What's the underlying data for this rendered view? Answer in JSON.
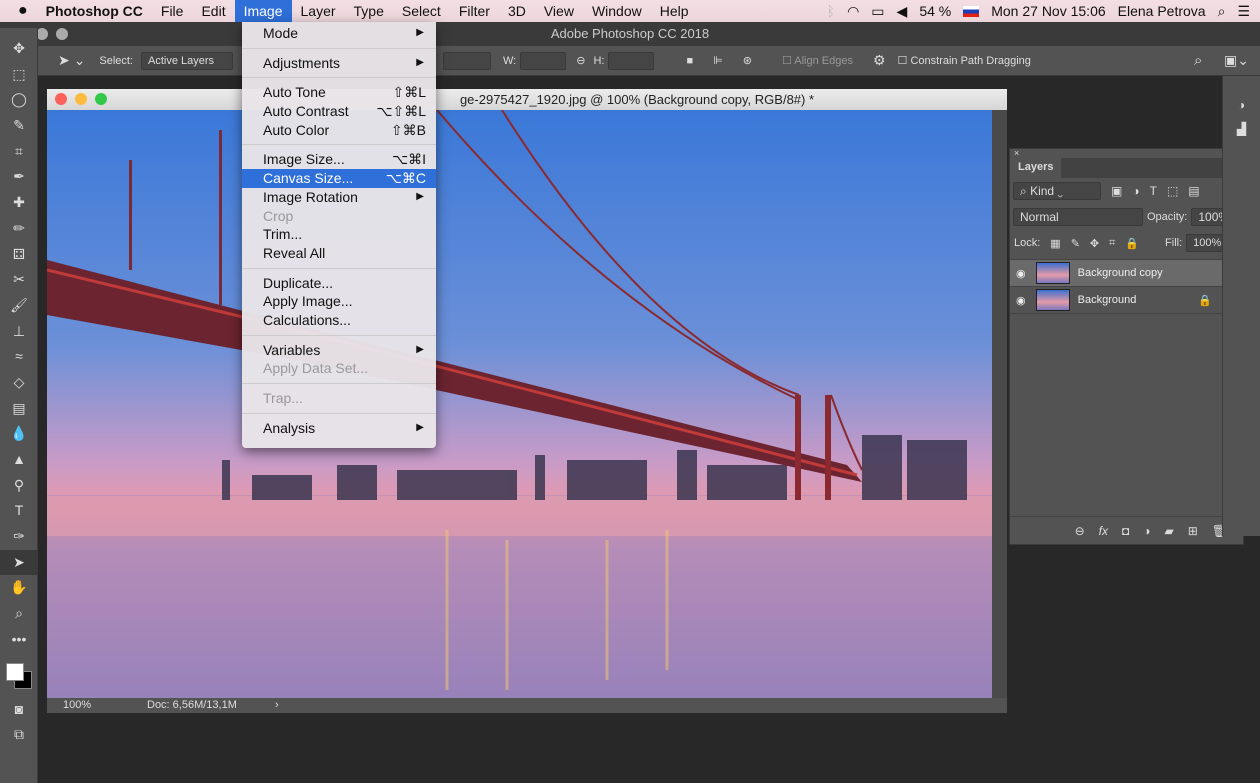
{
  "menubar": {
    "apple": "",
    "app": "Photoshop CC",
    "items": [
      "File",
      "Edit",
      "Image",
      "Layer",
      "Type",
      "Select",
      "Filter",
      "3D",
      "View",
      "Window",
      "Help"
    ],
    "battery": "54 %",
    "datetime": "Mon 27 Nov 15:06",
    "user": "Elena Petrova"
  },
  "window": {
    "title": "Adobe Photoshop CC 2018"
  },
  "options": {
    "select_label": "Select:",
    "select_value": "Active Layers",
    "w_label": "W:",
    "h_label": "H:",
    "align_edges": "Align Edges",
    "constrain": "Constrain Path Dragging"
  },
  "document": {
    "title": "ge-2975427_1920.jpg @ 100% (Background copy, RGB/8#) *",
    "zoom": "100%",
    "doc_info": "Doc: 6,56M/13,1M"
  },
  "image_menu": {
    "items": [
      {
        "label": "Mode",
        "submenu": true
      },
      {
        "sep": true
      },
      {
        "label": "Adjustments",
        "submenu": true
      },
      {
        "sep": true
      },
      {
        "label": "Auto Tone",
        "shortcut": "⇧⌘L"
      },
      {
        "label": "Auto Contrast",
        "shortcut": "⌥⇧⌘L"
      },
      {
        "label": "Auto Color",
        "shortcut": "⇧⌘B"
      },
      {
        "sep": true
      },
      {
        "label": "Image Size...",
        "shortcut": "⌥⌘I"
      },
      {
        "label": "Canvas Size...",
        "shortcut": "⌥⌘C",
        "highlighted": true
      },
      {
        "label": "Image Rotation",
        "submenu": true
      },
      {
        "label": "Crop",
        "disabled": true
      },
      {
        "label": "Trim..."
      },
      {
        "label": "Reveal All"
      },
      {
        "sep": true
      },
      {
        "label": "Duplicate..."
      },
      {
        "label": "Apply Image..."
      },
      {
        "label": "Calculations..."
      },
      {
        "sep": true
      },
      {
        "label": "Variables",
        "submenu": true
      },
      {
        "label": "Apply Data Set...",
        "disabled": true
      },
      {
        "sep": true
      },
      {
        "label": "Trap...",
        "disabled": true
      },
      {
        "sep": true
      },
      {
        "label": "Analysis",
        "submenu": true
      }
    ]
  },
  "layers": {
    "tab": "Layers",
    "filter": "Kind",
    "blend": "Normal",
    "opacity_label": "Opacity:",
    "opacity": "100%",
    "lock_label": "Lock:",
    "fill_label": "Fill:",
    "fill": "100%",
    "items": [
      {
        "name": "Background copy",
        "selected": true
      },
      {
        "name": "Background",
        "locked": true
      }
    ]
  },
  "colors": {
    "accent": "#2e6fd9",
    "panel": "#535353",
    "workspace": "#282828"
  }
}
